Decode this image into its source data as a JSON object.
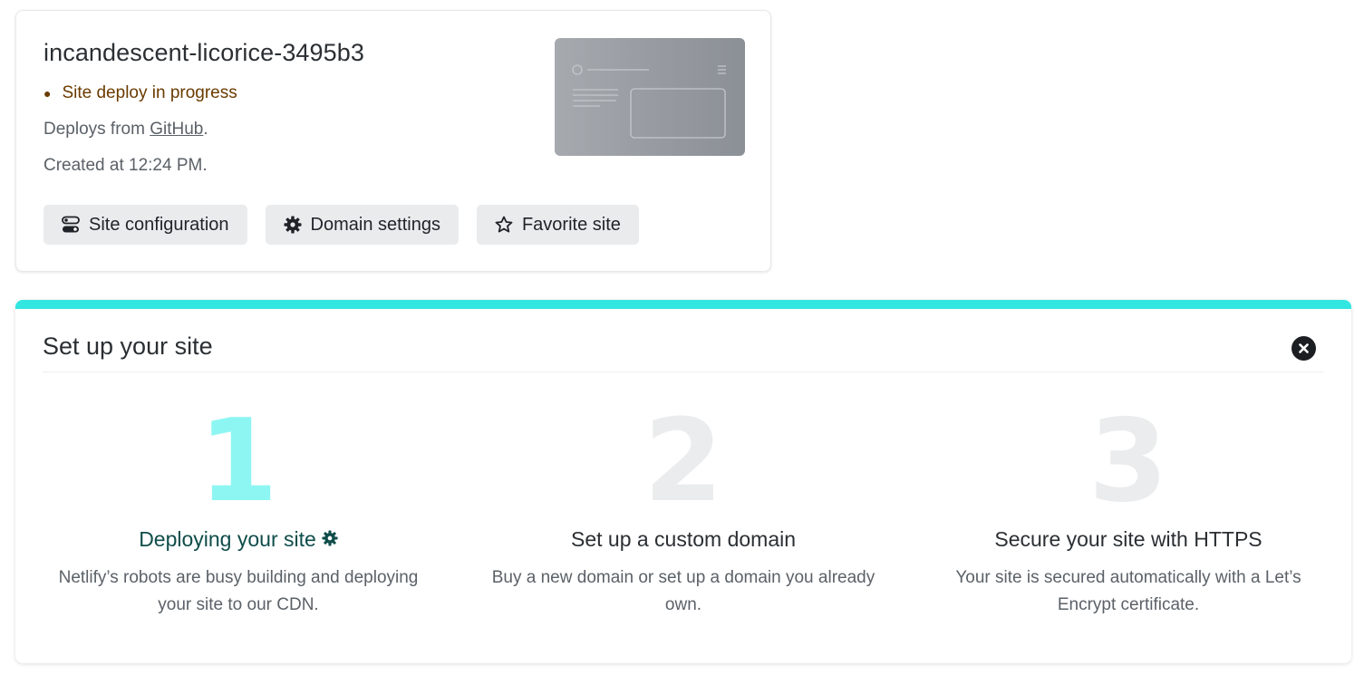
{
  "site": {
    "name": "incandescent-licorice-3495b3",
    "status": "Site deploy in progress",
    "deploys_from_prefix": "Deploys from ",
    "deploys_from_link": "GitHub",
    "deploys_from_suffix": ".",
    "created_at": "Created at 12:24 PM.",
    "buttons": {
      "site_configuration": "Site configuration",
      "domain_settings": "Domain settings",
      "favorite_site": "Favorite site"
    }
  },
  "setup": {
    "title": "Set up your site",
    "steps": [
      {
        "number": "1",
        "title": "Deploying your site",
        "description": "Netlify’s robots are busy building and deploying your site to our CDN.",
        "active": true
      },
      {
        "number": "2",
        "title": "Set up a custom domain",
        "description": "Buy a new domain or set up a domain you already own.",
        "active": false
      },
      {
        "number": "3",
        "title": "Secure your site with HTTPS",
        "description": "Your site is secured automatically with a Let’s Encrypt certificate.",
        "active": false
      }
    ]
  },
  "colors": {
    "accent": "#32e6e2",
    "active_step_number": "#8ef6f2",
    "active_step_title": "#0f4d4a",
    "inactive_step_number": "#ebeced",
    "status": "#6a3b00"
  },
  "icons": {
    "site_configuration": "toggles-icon",
    "domain_settings": "gear-icon",
    "favorite_site": "star-icon",
    "close": "close-circle-icon",
    "deploying": "gear-spinner-icon"
  }
}
